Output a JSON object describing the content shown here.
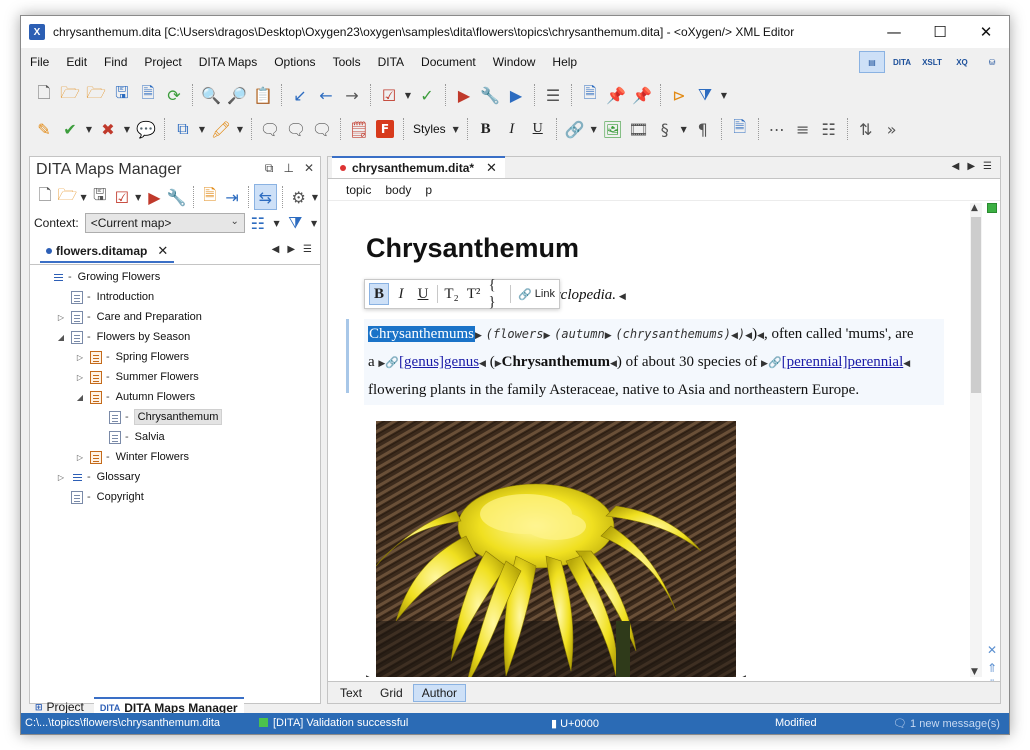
{
  "window": {
    "title": "chrysanthemum.dita [C:\\Users\\dragos\\Desktop\\Oxygen23\\oxygen\\samples\\dita\\flowers\\topics\\chrysanthemum.dita] - <oXygen/> XML Editor",
    "app_icon_letter": "X"
  },
  "menu": [
    "File",
    "Edit",
    "Find",
    "Project",
    "DITA Maps",
    "Options",
    "Tools",
    "DITA",
    "Document",
    "Window",
    "Help"
  ],
  "perspectives": [
    "DITA",
    "XSLT",
    "XQ"
  ],
  "toolbar2": {
    "styles_label": "Styles"
  },
  "maps_manager": {
    "title": "DITA Maps Manager",
    "context_label": "Context:",
    "context_value": "<Current map>",
    "tab_label": "flowers.ditamap",
    "tree": [
      {
        "label": "Growing Flowers",
        "level": 0,
        "twisty": "",
        "icon": "root"
      },
      {
        "label": "Introduction",
        "level": 1,
        "twisty": "",
        "icon": "topic"
      },
      {
        "label": "Care and Preparation",
        "level": 1,
        "twisty": "▷",
        "icon": "topic"
      },
      {
        "label": "Flowers by Season",
        "level": 1,
        "twisty": "◢",
        "icon": "topic"
      },
      {
        "label": "Spring Flowers",
        "level": 2,
        "twisty": "▷",
        "icon": "map"
      },
      {
        "label": "Summer Flowers",
        "level": 2,
        "twisty": "▷",
        "icon": "map"
      },
      {
        "label": "Autumn Flowers",
        "level": 2,
        "twisty": "◢",
        "icon": "map"
      },
      {
        "label": "Chrysanthemum",
        "level": 3,
        "twisty": "",
        "icon": "topic",
        "selected": true
      },
      {
        "label": "Salvia",
        "level": 3,
        "twisty": "",
        "icon": "topic"
      },
      {
        "label": "Winter Flowers",
        "level": 2,
        "twisty": "▷",
        "icon": "map"
      },
      {
        "label": "Glossary",
        "level": 1,
        "twisty": "▷",
        "icon": "root"
      },
      {
        "label": "Copyright",
        "level": 1,
        "twisty": "",
        "icon": "topic"
      }
    ],
    "bottom_tabs": {
      "project": "Project",
      "maps_manager": "DITA Maps Manager",
      "maps_icon": "DITA"
    }
  },
  "editor": {
    "tab_label": "chrysanthemum.dita*",
    "breadcrumb": [
      "topic",
      "body",
      "p"
    ],
    "doc_title": "Chrysanthemum",
    "shortdesc_visible": "yclopedia.",
    "floatbar": {
      "bold": "B",
      "italic": "I",
      "underline": "U",
      "subscript": "T₂",
      "superscript": "T²",
      "code": "{ }",
      "link": "Link"
    },
    "para": {
      "selected": "Chrysanthemums",
      "kw1": "(flowers",
      "kw2": "(autumn",
      "kw3": "(chrysanthemums)",
      "text1": ", often called 'mums', are",
      "text2": "a ",
      "xref1": "[genus]genus",
      "text3": "(",
      "term": "Chrysanthemum",
      "text4": ") of about 30 species of ",
      "xref2": "[perennial]perennial",
      "text5": "flowering plants in the family Asteraceae, native to Asia and northeastern Europe."
    },
    "bottom_tabs": [
      "Text",
      "Grid",
      "Author"
    ]
  },
  "status": {
    "path": "C:\\...\\topics\\flowers\\chrysanthemum.dita",
    "validation": "[DITA] Validation successful",
    "unicode": "U+0000",
    "modified": "Modified",
    "messages": "1 new message(s)"
  }
}
